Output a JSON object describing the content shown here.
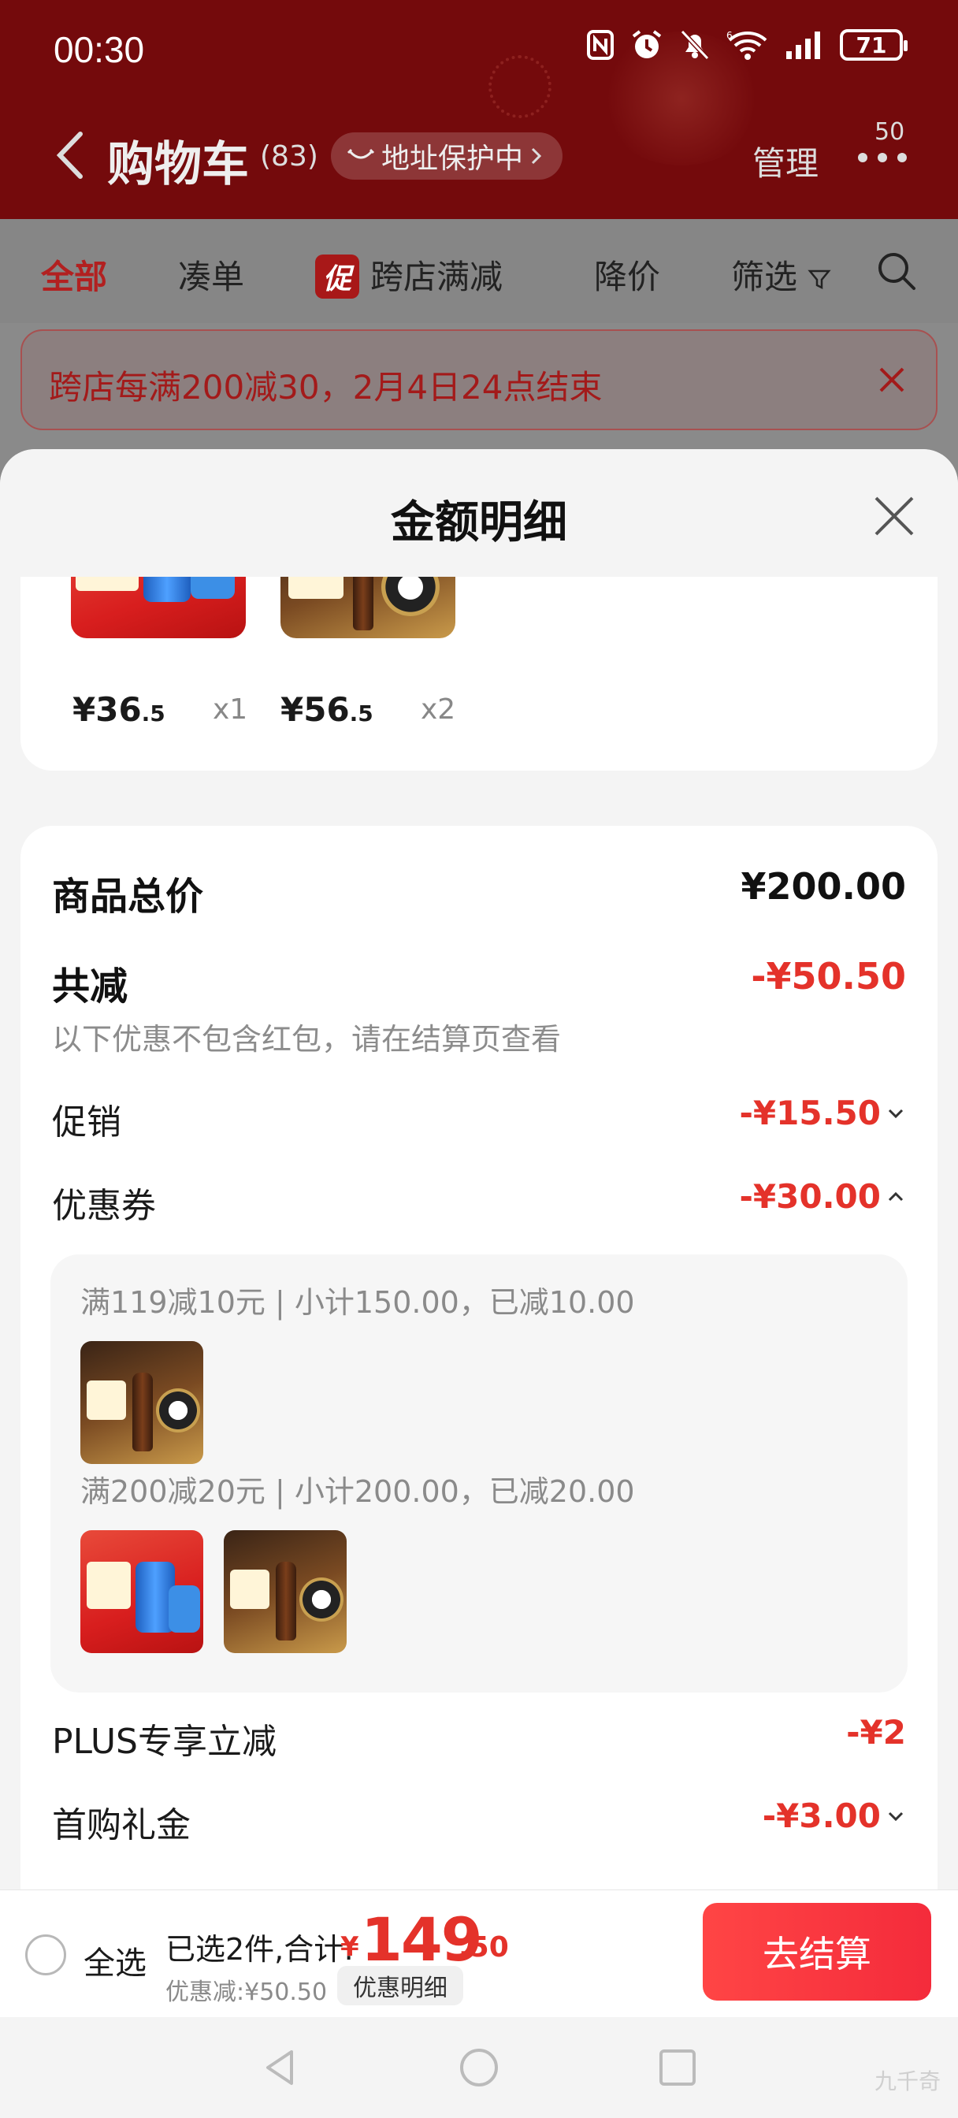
{
  "status_bar": {
    "time": "00:30",
    "battery": "71",
    "icons": [
      "nfc-icon",
      "alarm-icon",
      "mute-icon",
      "wifi-6-icon",
      "signal-icon",
      "battery-icon"
    ]
  },
  "header": {
    "title": "购物车",
    "count": "(83)",
    "address_protection": "地址保护中",
    "manage": "管理",
    "more_badge": "50",
    "colors": {
      "header_bg": "#740a0c",
      "accent": "#e4322a"
    }
  },
  "tabs": [
    {
      "label": "全部",
      "active": true
    },
    {
      "label": "凑单",
      "active": false
    },
    {
      "label": "跨店满减",
      "tag": "促",
      "active": false
    },
    {
      "label": "降价",
      "active": false
    },
    {
      "label": "筛选",
      "active": false
    }
  ],
  "banner": {
    "text": "跨店每满200减30，2月4日24点结束"
  },
  "sheet": {
    "title": "金额明细",
    "products": [
      {
        "price_int": "¥36",
        "price_dec": ".5",
        "qty": "x1",
        "image": "beer-can-blue"
      },
      {
        "price_int": "¥56",
        "price_dec": ".5",
        "qty": "x2",
        "image": "beer-bottle-gift-box"
      }
    ],
    "summary": {
      "total_label": "商品总价",
      "total_value": "¥200.00",
      "reduce_label": "共减",
      "reduce_value": "-¥50.50",
      "reduce_note": "以下优惠不包含红包，请在结算页查看",
      "promo_label": "促销",
      "promo_value": "-¥15.50",
      "coupon_label": "优惠券",
      "coupon_value": "-¥30.00",
      "coupons": [
        {
          "text": "满119减10元 | 小计150.00，已减10.00"
        },
        {
          "text": "满200减20元 | 小计200.00，已减20.00"
        }
      ],
      "plus_label": "PLUS专享立减",
      "plus_value": "-¥2",
      "firstbuy_label": "首购礼金",
      "firstbuy_value": "-¥3.00"
    }
  },
  "checkout": {
    "select_all": "全选",
    "selected_text": "已选2件,合计:",
    "currency": "¥",
    "total_int": "149",
    "total_dec": ".50",
    "discount_text": "优惠减:¥50.50",
    "detail_chip": "优惠明细",
    "button": "去结算"
  },
  "watermark": "九千奇"
}
